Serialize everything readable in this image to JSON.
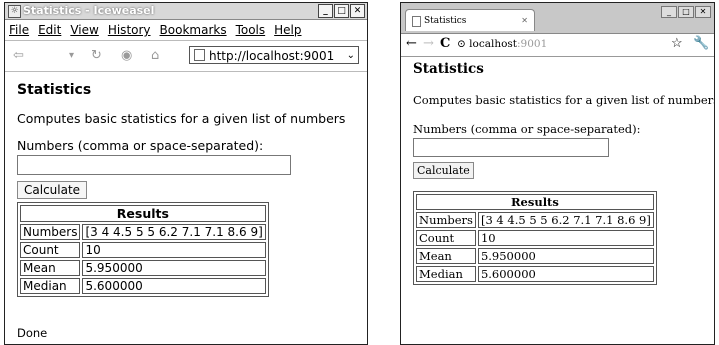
{
  "left": {
    "window_title": "Statistics - Iceweasel",
    "menu": [
      "File",
      "Edit",
      "View",
      "History",
      "Bookmarks",
      "Tools",
      "Help"
    ],
    "url": "http://localhost:9001",
    "page": {
      "heading": "Statistics",
      "description": "Computes basic statistics for a given list of numbers",
      "input_label": "Numbers (comma or space-separated):",
      "input_value": "",
      "button_label": "Calculate",
      "results_header": "Results",
      "rows": [
        {
          "label": "Numbers",
          "value": "[3 4 4.5 5 5 6.2 7.1 7.1 8.6 9]"
        },
        {
          "label": "Count",
          "value": "10"
        },
        {
          "label": "Mean",
          "value": "5.950000"
        },
        {
          "label": "Median",
          "value": "5.600000"
        }
      ]
    },
    "status": "Done"
  },
  "right": {
    "tab_title": "Statistics",
    "url": {
      "host": "localhost",
      "port": ":9001"
    },
    "page": {
      "heading": "Statistics",
      "description": "Computes basic statistics for a given list of numbers",
      "input_label": "Numbers (comma or space-separated):",
      "input_value": "",
      "button_label": "Calculate",
      "results_header": "Results",
      "rows": [
        {
          "label": "Numbers",
          "value": "[3 4 4.5 5 5 6.2 7.1 7.1 8.6 9]"
        },
        {
          "label": "Count",
          "value": "10"
        },
        {
          "label": "Mean",
          "value": "5.950000"
        },
        {
          "label": "Median",
          "value": "5.600000"
        }
      ]
    }
  },
  "icons": {
    "back": "back-arrow-icon",
    "forward": "forward-arrow-icon",
    "reload": "reload-icon",
    "stop": "stop-icon",
    "home": "home-icon",
    "page": "page-icon",
    "star": "star-icon",
    "wrench": "wrench-icon"
  }
}
